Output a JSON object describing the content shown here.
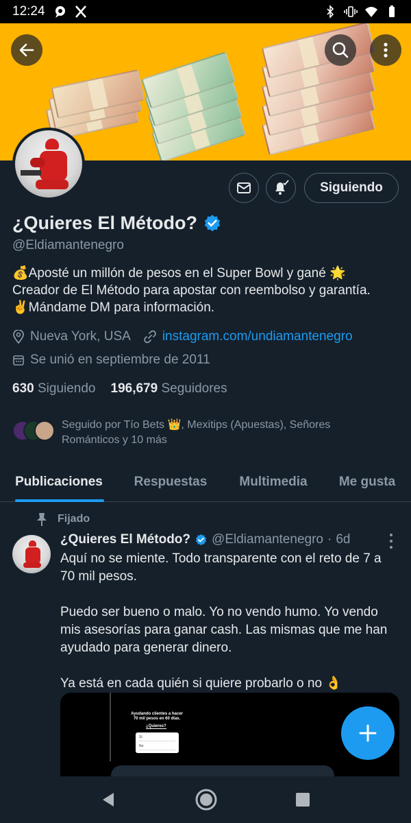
{
  "status_bar": {
    "time": "12:24"
  },
  "profile": {
    "name": "¿Quieres El Método?",
    "handle": "@Eldiamantenegro",
    "bio_lines": [
      "💰Aposté un millón de pesos en el Super Bowl y gané 🌟",
      "Creador de El Método para apostar con reembolso y garantía.",
      "✌️Mándame DM para información."
    ],
    "location": "Nueva York, USA",
    "link": "instagram.com/undiamantenegro",
    "joined": "Se unió en septiembre de 2011",
    "following_count": "630",
    "following_label": "Siguiendo",
    "followers_count": "196,679",
    "followers_label": "Seguidores",
    "followed_by": "Seguido por Tío Bets 👑, Mexitips (Apuestas), Señores Románticos y 10 más",
    "follow_button": "Siguiendo"
  },
  "tabs": [
    {
      "label": "Publicaciones",
      "active": true
    },
    {
      "label": "Respuestas",
      "active": false
    },
    {
      "label": "Multimedia",
      "active": false
    },
    {
      "label": "Me gusta",
      "active": false
    }
  ],
  "pinned_post": {
    "pinned_label": "Fijado",
    "author_name": "¿Quieres El Método?",
    "author_handle": "@Eldiamantenegro",
    "separator": "·",
    "age": "6d",
    "text": "Aquí no se miente. Todo transparente con el reto de 7 a 70 mil pesos.\n\nPuedo ser bueno o malo. Yo no vendo humo. Yo vendo mis asesorías para ganar cash. Las mismas que me han ayudado para generar dinero.\n\nYa está en cada quién si quiere probarlo o no 👌",
    "media_title": "Ayudando clientes a hacer 70 mil pesos en 60 días.",
    "media_subtitle": "¿Quieres?",
    "media_options": [
      "Sí",
      "No"
    ]
  },
  "colors": {
    "accent": "#1d9bf0",
    "background": "#15202b",
    "banner": "#ffb400"
  },
  "icons": [
    "back-arrow-icon",
    "search-icon",
    "more-vertical-icon",
    "mail-icon",
    "notification-bell-icon",
    "verified-badge-icon",
    "location-icon",
    "link-icon",
    "calendar-icon",
    "pin-icon",
    "plus-icon"
  ]
}
